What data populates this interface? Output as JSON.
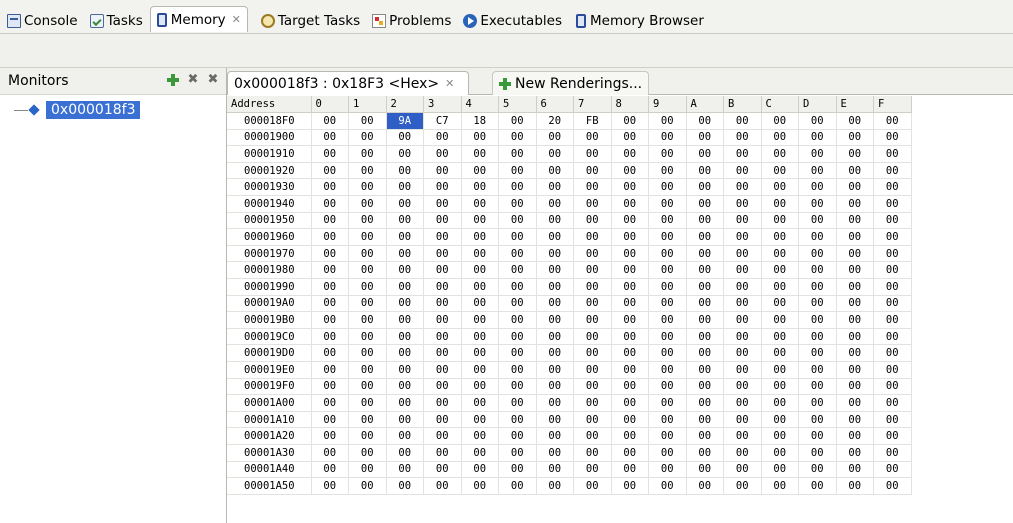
{
  "top_tabs": [
    {
      "label": "Console",
      "icon": "console-icon"
    },
    {
      "label": "Tasks",
      "icon": "tasks-icon"
    },
    {
      "label": "Memory",
      "icon": "memory-icon",
      "active": true
    },
    {
      "label": "Target Tasks",
      "icon": "target-tasks-icon"
    },
    {
      "label": "Problems",
      "icon": "problems-icon"
    },
    {
      "label": "Executables",
      "icon": "executables-icon"
    },
    {
      "label": "Memory Browser",
      "icon": "memory-icon"
    }
  ],
  "monitors": {
    "title": "Monitors",
    "items": [
      {
        "label": "0x000018f3",
        "selected": true
      }
    ]
  },
  "renderings": {
    "active_tab": "0x000018f3 : 0x18F3 <Hex>",
    "new_tab": "New Renderings..."
  },
  "memory_table": {
    "headers": [
      "Address",
      "0",
      "1",
      "2",
      "3",
      "4",
      "5",
      "6",
      "7",
      "8",
      "9",
      "A",
      "B",
      "C",
      "D",
      "E",
      "F"
    ],
    "selected": {
      "row": 0,
      "col": 3
    },
    "rows": [
      [
        "000018F0",
        "00",
        "00",
        "9A",
        "C7",
        "18",
        "00",
        "20",
        "FB",
        "00",
        "00",
        "00",
        "00",
        "00",
        "00",
        "00",
        "00"
      ],
      [
        "00001900",
        "00",
        "00",
        "00",
        "00",
        "00",
        "00",
        "00",
        "00",
        "00",
        "00",
        "00",
        "00",
        "00",
        "00",
        "00",
        "00"
      ],
      [
        "00001910",
        "00",
        "00",
        "00",
        "00",
        "00",
        "00",
        "00",
        "00",
        "00",
        "00",
        "00",
        "00",
        "00",
        "00",
        "00",
        "00"
      ],
      [
        "00001920",
        "00",
        "00",
        "00",
        "00",
        "00",
        "00",
        "00",
        "00",
        "00",
        "00",
        "00",
        "00",
        "00",
        "00",
        "00",
        "00"
      ],
      [
        "00001930",
        "00",
        "00",
        "00",
        "00",
        "00",
        "00",
        "00",
        "00",
        "00",
        "00",
        "00",
        "00",
        "00",
        "00",
        "00",
        "00"
      ],
      [
        "00001940",
        "00",
        "00",
        "00",
        "00",
        "00",
        "00",
        "00",
        "00",
        "00",
        "00",
        "00",
        "00",
        "00",
        "00",
        "00",
        "00"
      ],
      [
        "00001950",
        "00",
        "00",
        "00",
        "00",
        "00",
        "00",
        "00",
        "00",
        "00",
        "00",
        "00",
        "00",
        "00",
        "00",
        "00",
        "00"
      ],
      [
        "00001960",
        "00",
        "00",
        "00",
        "00",
        "00",
        "00",
        "00",
        "00",
        "00",
        "00",
        "00",
        "00",
        "00",
        "00",
        "00",
        "00"
      ],
      [
        "00001970",
        "00",
        "00",
        "00",
        "00",
        "00",
        "00",
        "00",
        "00",
        "00",
        "00",
        "00",
        "00",
        "00",
        "00",
        "00",
        "00"
      ],
      [
        "00001980",
        "00",
        "00",
        "00",
        "00",
        "00",
        "00",
        "00",
        "00",
        "00",
        "00",
        "00",
        "00",
        "00",
        "00",
        "00",
        "00"
      ],
      [
        "00001990",
        "00",
        "00",
        "00",
        "00",
        "00",
        "00",
        "00",
        "00",
        "00",
        "00",
        "00",
        "00",
        "00",
        "00",
        "00",
        "00"
      ],
      [
        "000019A0",
        "00",
        "00",
        "00",
        "00",
        "00",
        "00",
        "00",
        "00",
        "00",
        "00",
        "00",
        "00",
        "00",
        "00",
        "00",
        "00"
      ],
      [
        "000019B0",
        "00",
        "00",
        "00",
        "00",
        "00",
        "00",
        "00",
        "00",
        "00",
        "00",
        "00",
        "00",
        "00",
        "00",
        "00",
        "00"
      ],
      [
        "000019C0",
        "00",
        "00",
        "00",
        "00",
        "00",
        "00",
        "00",
        "00",
        "00",
        "00",
        "00",
        "00",
        "00",
        "00",
        "00",
        "00"
      ],
      [
        "000019D0",
        "00",
        "00",
        "00",
        "00",
        "00",
        "00",
        "00",
        "00",
        "00",
        "00",
        "00",
        "00",
        "00",
        "00",
        "00",
        "00"
      ],
      [
        "000019E0",
        "00",
        "00",
        "00",
        "00",
        "00",
        "00",
        "00",
        "00",
        "00",
        "00",
        "00",
        "00",
        "00",
        "00",
        "00",
        "00"
      ],
      [
        "000019F0",
        "00",
        "00",
        "00",
        "00",
        "00",
        "00",
        "00",
        "00",
        "00",
        "00",
        "00",
        "00",
        "00",
        "00",
        "00",
        "00"
      ],
      [
        "00001A00",
        "00",
        "00",
        "00",
        "00",
        "00",
        "00",
        "00",
        "00",
        "00",
        "00",
        "00",
        "00",
        "00",
        "00",
        "00",
        "00"
      ],
      [
        "00001A10",
        "00",
        "00",
        "00",
        "00",
        "00",
        "00",
        "00",
        "00",
        "00",
        "00",
        "00",
        "00",
        "00",
        "00",
        "00",
        "00"
      ],
      [
        "00001A20",
        "00",
        "00",
        "00",
        "00",
        "00",
        "00",
        "00",
        "00",
        "00",
        "00",
        "00",
        "00",
        "00",
        "00",
        "00",
        "00"
      ],
      [
        "00001A30",
        "00",
        "00",
        "00",
        "00",
        "00",
        "00",
        "00",
        "00",
        "00",
        "00",
        "00",
        "00",
        "00",
        "00",
        "00",
        "00"
      ],
      [
        "00001A40",
        "00",
        "00",
        "00",
        "00",
        "00",
        "00",
        "00",
        "00",
        "00",
        "00",
        "00",
        "00",
        "00",
        "00",
        "00",
        "00"
      ],
      [
        "00001A50",
        "00",
        "00",
        "00",
        "00",
        "00",
        "00",
        "00",
        "00",
        "00",
        "00",
        "00",
        "00",
        "00",
        "00",
        "00",
        "00"
      ]
    ]
  },
  "colors": {
    "selection": "#2f5fc6",
    "monitor_highlight": "#3a6fd4"
  }
}
